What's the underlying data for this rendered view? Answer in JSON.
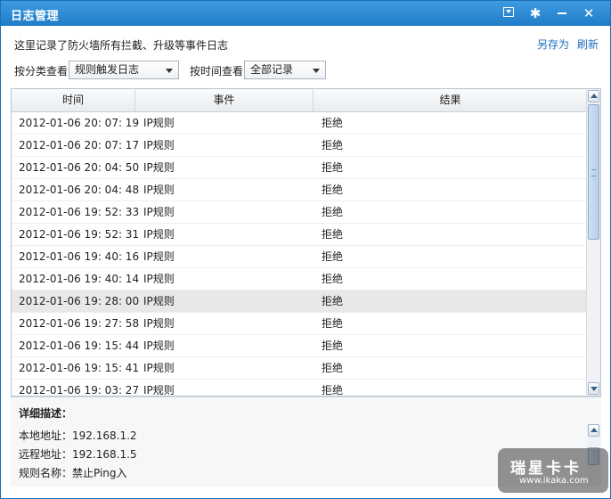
{
  "window": {
    "title": "日志管理",
    "controls": {
      "menu_icon": "dropdown-box-icon",
      "settings_icon": "gear-icon",
      "minimize_icon": "minimize-icon",
      "close_icon": "close-icon",
      "close_glyph": "✕",
      "gear_glyph": "✱"
    }
  },
  "header": {
    "description": "这里记录了防火墙所有拦截、升级等事件日志",
    "save_as": "另存为",
    "refresh": "刷新"
  },
  "filters": {
    "category_label": "按分类查看",
    "category_value": "规则触发日志",
    "time_label": "按时间查看",
    "time_value": "全部记录"
  },
  "table": {
    "columns": [
      "时间",
      "事件",
      "结果"
    ],
    "rows": [
      {
        "time": "2012-01-06 20: 07: 19",
        "event": "IP规则",
        "result": "拒绝"
      },
      {
        "time": "2012-01-06 20: 07: 17",
        "event": "IP规则",
        "result": "拒绝"
      },
      {
        "time": "2012-01-06 20: 04: 50",
        "event": "IP规则",
        "result": "拒绝"
      },
      {
        "time": "2012-01-06 20: 04: 48",
        "event": "IP规则",
        "result": "拒绝"
      },
      {
        "time": "2012-01-06 19: 52: 33",
        "event": "IP规则",
        "result": "拒绝"
      },
      {
        "time": "2012-01-06 19: 52: 31",
        "event": "IP规则",
        "result": "拒绝"
      },
      {
        "time": "2012-01-06 19: 40: 16",
        "event": "IP规则",
        "result": "拒绝"
      },
      {
        "time": "2012-01-06 19: 40: 14",
        "event": "IP规则",
        "result": "拒绝"
      },
      {
        "time": "2012-01-06 19: 28: 00",
        "event": "IP规则",
        "result": "拒绝"
      },
      {
        "time": "2012-01-06 19: 27: 58",
        "event": "IP规则",
        "result": "拒绝"
      },
      {
        "time": "2012-01-06 19: 15: 44",
        "event": "IP规则",
        "result": "拒绝"
      },
      {
        "time": "2012-01-06 19: 15: 41",
        "event": "IP规则",
        "result": "拒绝"
      },
      {
        "time": "2012-01-06 19: 03: 27",
        "event": "IP规则",
        "result": "拒绝"
      }
    ],
    "selected_row": 8
  },
  "detail": {
    "title": "详细描述：",
    "lines": [
      "本地地址：192.168.1.2",
      "远程地址：192.168.1.5",
      "规则名称：禁止Ping入"
    ]
  },
  "watermark": {
    "brand": "瑞星卡卡",
    "url": "www.ikaka.com"
  },
  "colors": {
    "titlebar": "#2a88d3",
    "link": "#1f6fc0",
    "selected_row": "#e8e8e8"
  }
}
